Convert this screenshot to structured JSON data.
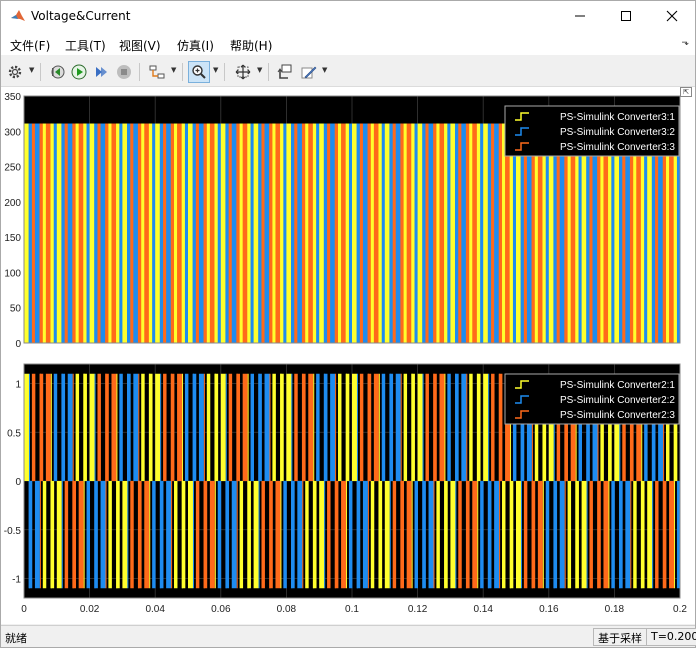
{
  "window": {
    "title": "Voltage&Current"
  },
  "menu": [
    "文件(F)",
    "工具(T)",
    "视图(V)",
    "仿真(I)",
    "帮助(H)"
  ],
  "toolbar": {
    "icons": [
      "gear-icon",
      "step-back-icon",
      "run-icon",
      "step-forward-icon",
      "stop-icon",
      "signal-select-icon",
      "zoom-icon",
      "fit-axes-icon",
      "highlight-block-icon",
      "style-icon"
    ]
  },
  "status": {
    "text": "就绪",
    "mode": "基于采样",
    "time": "T=0.200"
  },
  "colors": {
    "yellow": "#ffff2d",
    "blue": "#1e8cf0",
    "orange": "#ff6a1a",
    "plot_bg": "#000000"
  },
  "chart_data": [
    {
      "type": "line",
      "title": "",
      "xlabel": "",
      "ylabel": "",
      "xlim": [
        0,
        0.2
      ],
      "ylim": [
        0,
        350
      ],
      "yticks": [
        0,
        50,
        100,
        150,
        200,
        250,
        300,
        350
      ],
      "grid": true,
      "legend": "top-right",
      "waveform": {
        "kind": "pwm",
        "low": 0,
        "high": 311,
        "switching_periods_visible": 60
      },
      "series": [
        {
          "name": "PS-Simulink Converter3:1",
          "color": "#ffff2d"
        },
        {
          "name": "PS-Simulink Converter3:2",
          "color": "#1e8cf0"
        },
        {
          "name": "PS-Simulink Converter3:3",
          "color": "#ff6a1a"
        }
      ]
    },
    {
      "type": "line",
      "title": "",
      "xlabel": "",
      "ylabel": "",
      "xlim": [
        0,
        0.2
      ],
      "ylim": [
        -1.2,
        1.2
      ],
      "yticks": [
        1,
        0.5,
        0,
        -0.5,
        -1
      ],
      "xticks": [
        0,
        0.02,
        0.04,
        0.06,
        0.08,
        0.1,
        0.12,
        0.14,
        0.16,
        0.18,
        0.2
      ],
      "grid": true,
      "legend": "top-right",
      "waveform": {
        "kind": "pwm",
        "low": -1.1,
        "high": 1.1,
        "switching_periods_visible": 60
      },
      "series": [
        {
          "name": "PS-Simulink Converter2:1",
          "color": "#ffff2d"
        },
        {
          "name": "PS-Simulink Converter2:2",
          "color": "#1e8cf0"
        },
        {
          "name": "PS-Simulink Converter2:3",
          "color": "#ff6a1a"
        }
      ]
    }
  ]
}
